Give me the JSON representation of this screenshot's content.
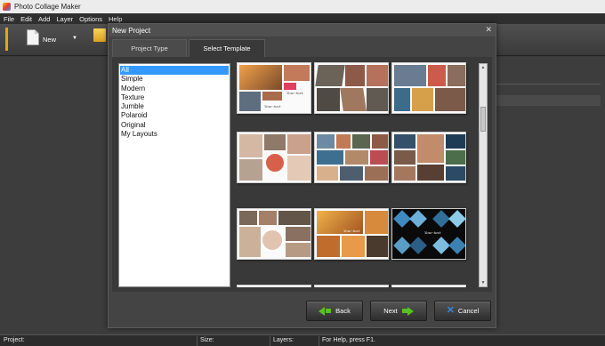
{
  "window": {
    "title": "Photo Collage Maker"
  },
  "menu": [
    "File",
    "Edit",
    "Add",
    "Layer",
    "Options",
    "Help"
  ],
  "toolbar": {
    "new_label": "New",
    "new_dropdown": "▼"
  },
  "dialog": {
    "title": "New Project",
    "close": "✕",
    "tabs": [
      "Project Type",
      "Select Template"
    ],
    "active_tab": "Select Template",
    "categories": [
      "All",
      "Simple",
      "Modern",
      "Texture",
      "Jumble",
      "Polaroid",
      "Original",
      "My Layouts"
    ],
    "selected_category": "All",
    "template_captions": [
      "Your text",
      "Your text",
      "Your text",
      "Your text"
    ],
    "buttons": {
      "back": "Back",
      "next": "Next",
      "cancel": "Cancel"
    }
  },
  "status": {
    "project": "Project:",
    "size": "Size:",
    "layers": "Layers:",
    "help": "For Help, press F1."
  },
  "colors": {
    "selection": "#3399ff",
    "accent": "#e2a51c",
    "arrow": "#56c21f",
    "cancel": "#3a86d8"
  }
}
